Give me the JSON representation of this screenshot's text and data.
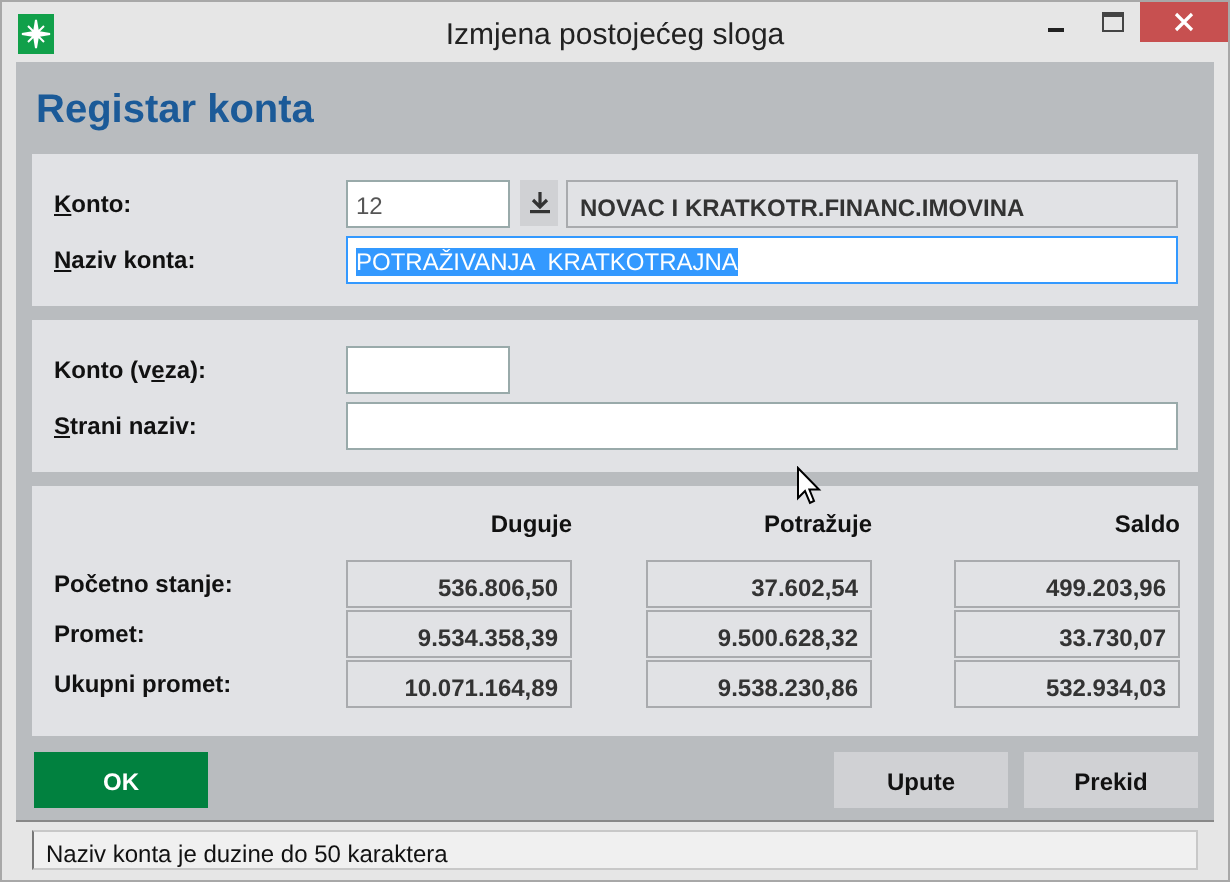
{
  "window": {
    "title": "Izmjena postojećeg sloga"
  },
  "header": "Registar konta",
  "sections": [
    {
      "fields": [
        {
          "kind": "lookup",
          "label": {
            "key": "K",
            "post": "onto:"
          },
          "value": "12",
          "description": "NOVAC I KRATKOTR.FINANC.IMOVINA"
        },
        {
          "kind": "wide",
          "label": {
            "key": "N",
            "post": "aziv konta:"
          },
          "value": "POTRAŽIVANJA  KRATKOTRAJNA",
          "selected": true
        }
      ]
    },
    {
      "fields": [
        {
          "kind": "short",
          "label": {
            "pre": "Konto (v",
            "key": "e",
            "post": "za):"
          }
        },
        {
          "kind": "wide",
          "label": {
            "key": "S",
            "post": "trani naziv:"
          },
          "selected": false
        }
      ]
    }
  ],
  "totals": {
    "columns": [
      "Duguje",
      "Potražuje",
      "Saldo"
    ],
    "rows": [
      {
        "label": "Početno stanje:",
        "values": [
          "536.806,50",
          "37.602,54",
          "499.203,96"
        ]
      },
      {
        "label": "Promet:",
        "values": [
          "9.534.358,39",
          "9.500.628,32",
          "33.730,07"
        ]
      },
      {
        "label": "Ukupni promet:",
        "values": [
          "10.071.164,89",
          "9.538.230,86",
          "532.934,03"
        ]
      }
    ]
  },
  "buttons": [
    {
      "label": "OK",
      "kind": "primary"
    },
    {
      "label": "Upute",
      "kind": "secondary"
    },
    {
      "label": "Prekid",
      "kind": "secondary"
    }
  ],
  "status_bar": "Naziv konta je duzine do 50 karaktera"
}
